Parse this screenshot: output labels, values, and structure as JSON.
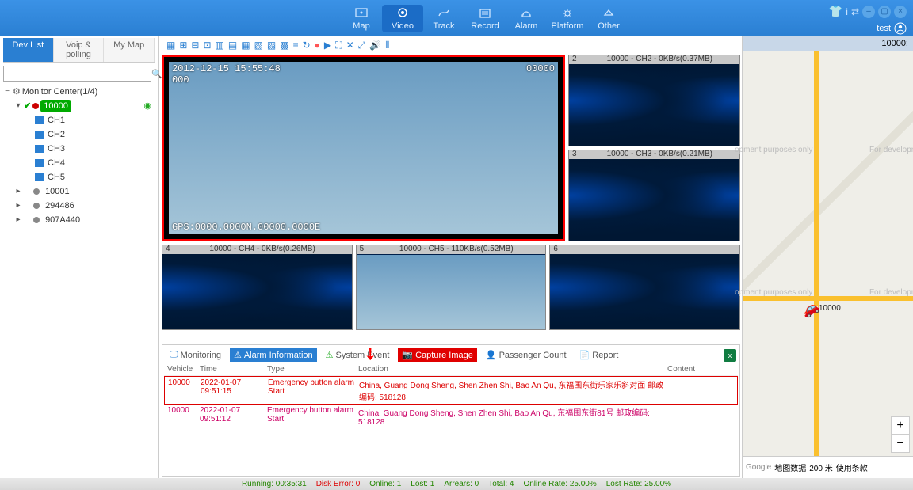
{
  "header": {
    "tabs": [
      {
        "id": "map",
        "label": "Map"
      },
      {
        "id": "video",
        "label": "Video",
        "active": true
      },
      {
        "id": "track",
        "label": "Track"
      },
      {
        "id": "record",
        "label": "Record"
      },
      {
        "id": "alarm",
        "label": "Alarm"
      },
      {
        "id": "platform",
        "label": "Platform"
      },
      {
        "id": "other",
        "label": "Other"
      }
    ],
    "user": "test"
  },
  "left": {
    "tabs": [
      "Dev List",
      "Voip & polling",
      "My Map"
    ],
    "root": "Monitor Center(1/4)",
    "active_device": "10000",
    "channels": [
      "CH1",
      "CH2",
      "CH3",
      "CH4",
      "CH5"
    ],
    "offline": [
      "10001",
      "294486",
      "907A440"
    ]
  },
  "map": {
    "label": "10000:",
    "marker": "10000",
    "foot_items": [
      "地图数据",
      "200 米",
      "使用条款"
    ]
  },
  "video": {
    "main": {
      "ts": "2012-12-15 15:55:48",
      "sub": "000",
      "counter": "00000",
      "gps": "GPS:0000.0000N.00000.0000E"
    },
    "tiles": [
      {
        "num": "2",
        "label": "10000 - CH2 - 0KB/s(0.37MB)"
      },
      {
        "num": "3",
        "label": "10000 - CH3 - 0KB/s(0.21MB)"
      },
      {
        "num": "4",
        "label": "10000 - CH4 - 0KB/s(0.26MB)"
      },
      {
        "num": "5",
        "label": "10000 - CH5 - 110KB/s(0.52MB)"
      },
      {
        "num": "6",
        "label": ""
      }
    ]
  },
  "panel": {
    "tabs": [
      "Monitoring",
      "Alarm Information",
      "System Event",
      "Capture Image",
      "Passenger Count",
      "Report"
    ],
    "cols": [
      "Vehicle",
      "Time",
      "Type",
      "Location",
      "Content"
    ],
    "rows": [
      {
        "v": "10000",
        "t": "2022-01-07 09:51:15",
        "ty": "Emergency button alarm Start",
        "l": "China, Guang Dong Sheng, Shen Zhen Shi, Bao An Qu, 东福围东街乐家乐斜对面 邮政编码: 518128",
        "c": ""
      },
      {
        "v": "10000",
        "t": "2022-01-07 09:51:12",
        "ty": "Emergency button alarm Start",
        "l": "China, Guang Dong Sheng, Shen Zhen Shi, Bao An Qu, 东福围东街81号 邮政编码: 518128",
        "c": ""
      }
    ]
  },
  "status": {
    "running": "Running:  00:35:31",
    "disk": "Disk Error:  0",
    "online": "Online:  1",
    "lost": "Lost:  1",
    "arrears": "Arrears:  0",
    "total": "Total:  4",
    "orate": "Online Rate: 25.00%",
    "lrate": "Lost Rate:  25.00%"
  }
}
